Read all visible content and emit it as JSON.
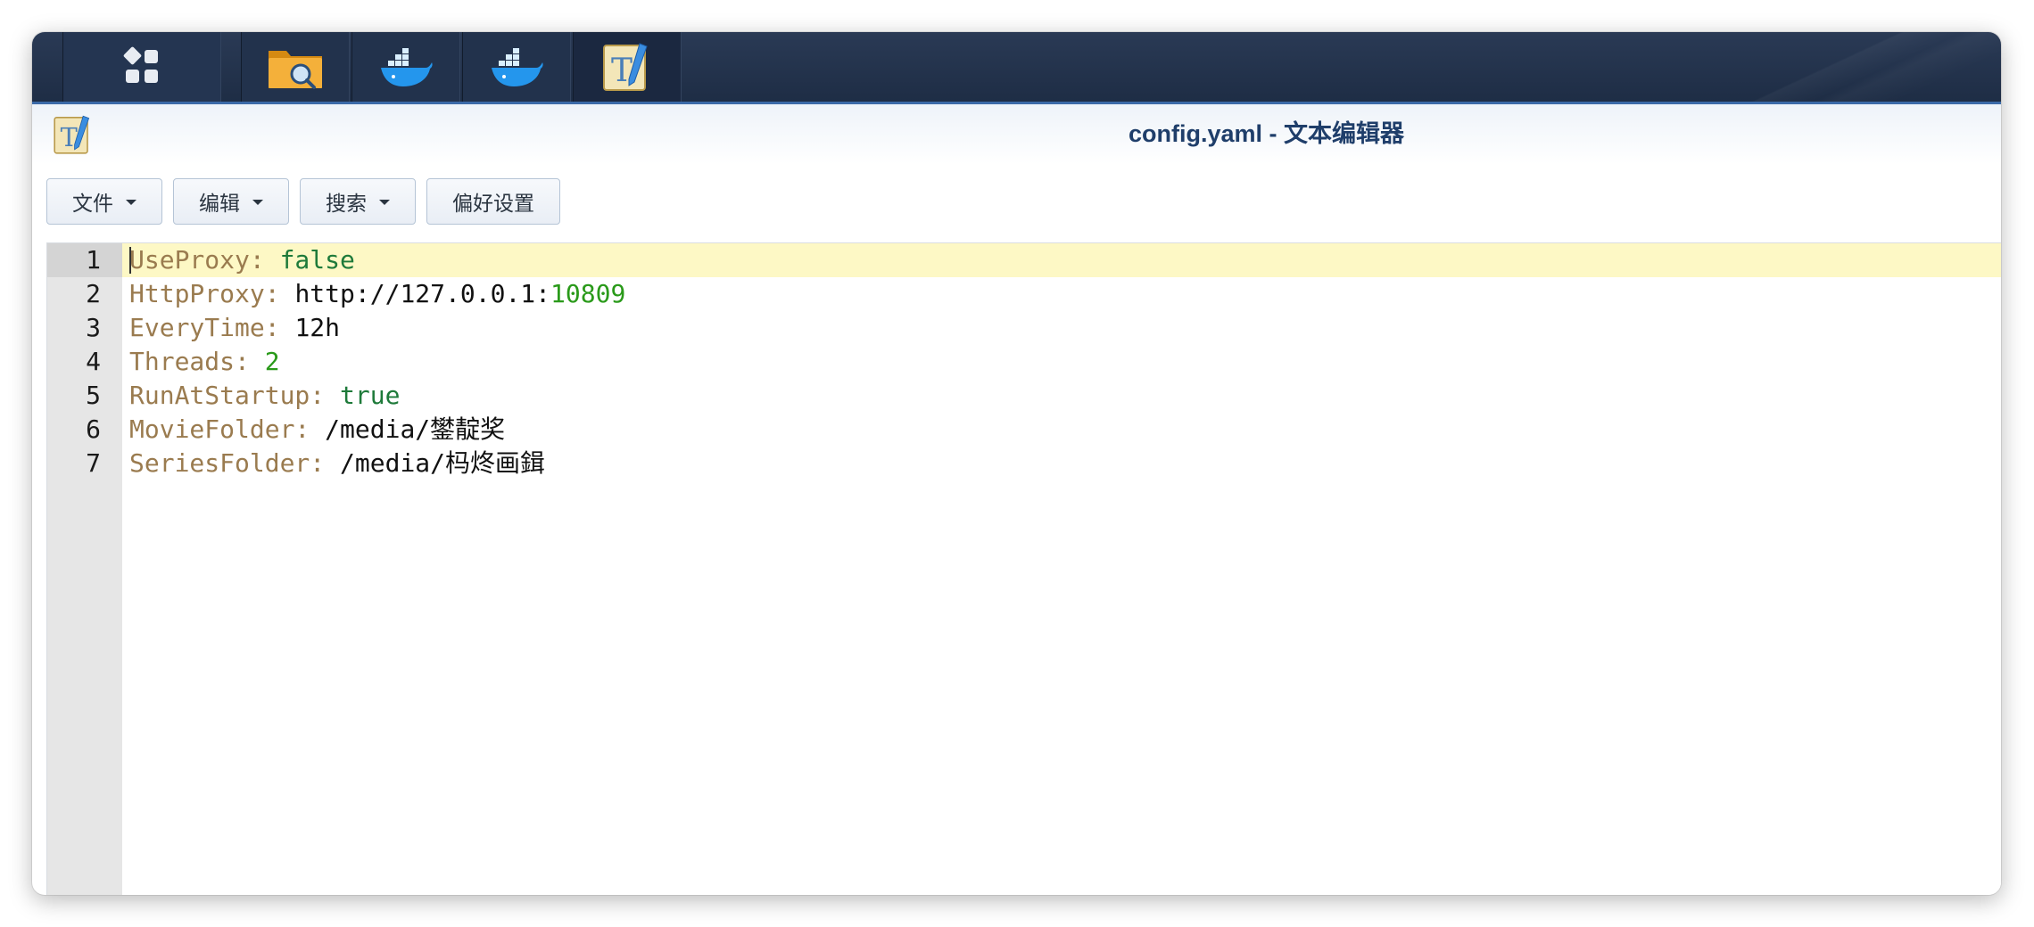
{
  "taskbar": {
    "items": [
      {
        "icon": "main-menu-icon",
        "active": false
      },
      {
        "icon": "file-station-icon",
        "active": false
      },
      {
        "icon": "docker-icon",
        "active": false
      },
      {
        "icon": "docker-icon",
        "active": false
      },
      {
        "icon": "text-editor-icon",
        "active": true
      }
    ]
  },
  "window": {
    "title": "config.yaml - 文本编辑器",
    "app_icon": "text-editor-icon"
  },
  "toolbar": {
    "file_label": "文件",
    "edit_label": "编辑",
    "search_label": "搜索",
    "prefs_label": "偏好设置"
  },
  "editor": {
    "active_line": 1,
    "lines": [
      {
        "number": "1",
        "key": "UseProxy:",
        "value": "false"
      },
      {
        "number": "2",
        "key": "HttpProxy:",
        "value": "http://127.0.0.1:",
        "value_extra": "10809"
      },
      {
        "number": "3",
        "key": "EveryTime:",
        "value": "12h"
      },
      {
        "number": "4",
        "key": "Threads:",
        "value": "2"
      },
      {
        "number": "5",
        "key": "RunAtStartup:",
        "value": "true"
      },
      {
        "number": "6",
        "key": "MovieFolder:",
        "value": "/media/鐢靛奖"
      },
      {
        "number": "7",
        "key": "SeriesFolder:",
        "value": "/media/杩炵画鍓"
      }
    ]
  },
  "colors": {
    "key": "#9a7b4f",
    "bool": "#1e7a3a",
    "number": "#2a9a1a",
    "active_line_bg": "#fdf8c5",
    "title": "#1f3e6a"
  }
}
